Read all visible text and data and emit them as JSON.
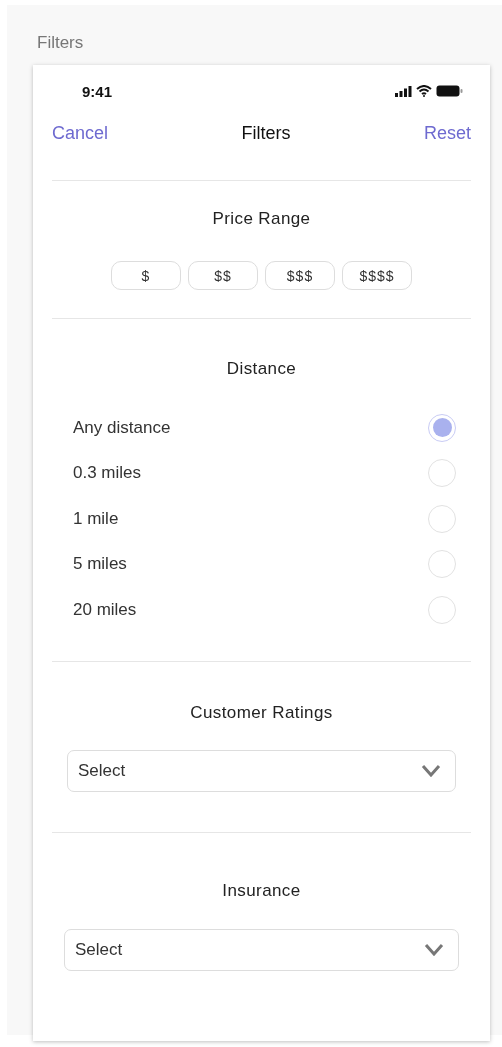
{
  "page_title": "Filters",
  "status_bar": {
    "time": "9:41"
  },
  "nav": {
    "left": "Cancel",
    "title": "Filters",
    "right": "Reset"
  },
  "price_range": {
    "title": "Price Range",
    "options": [
      "$",
      "$$",
      "$$$",
      "$$$$"
    ]
  },
  "distance": {
    "title": "Distance",
    "options": [
      {
        "label": "Any distance",
        "selected": true
      },
      {
        "label": "0.3 miles",
        "selected": false
      },
      {
        "label": "1 mile",
        "selected": false
      },
      {
        "label": "5 miles",
        "selected": false
      },
      {
        "label": "20 miles",
        "selected": false
      }
    ]
  },
  "customer_ratings": {
    "title": "Customer Ratings",
    "placeholder": "Select"
  },
  "insurance": {
    "title": "Insurance",
    "placeholder": "Select"
  }
}
